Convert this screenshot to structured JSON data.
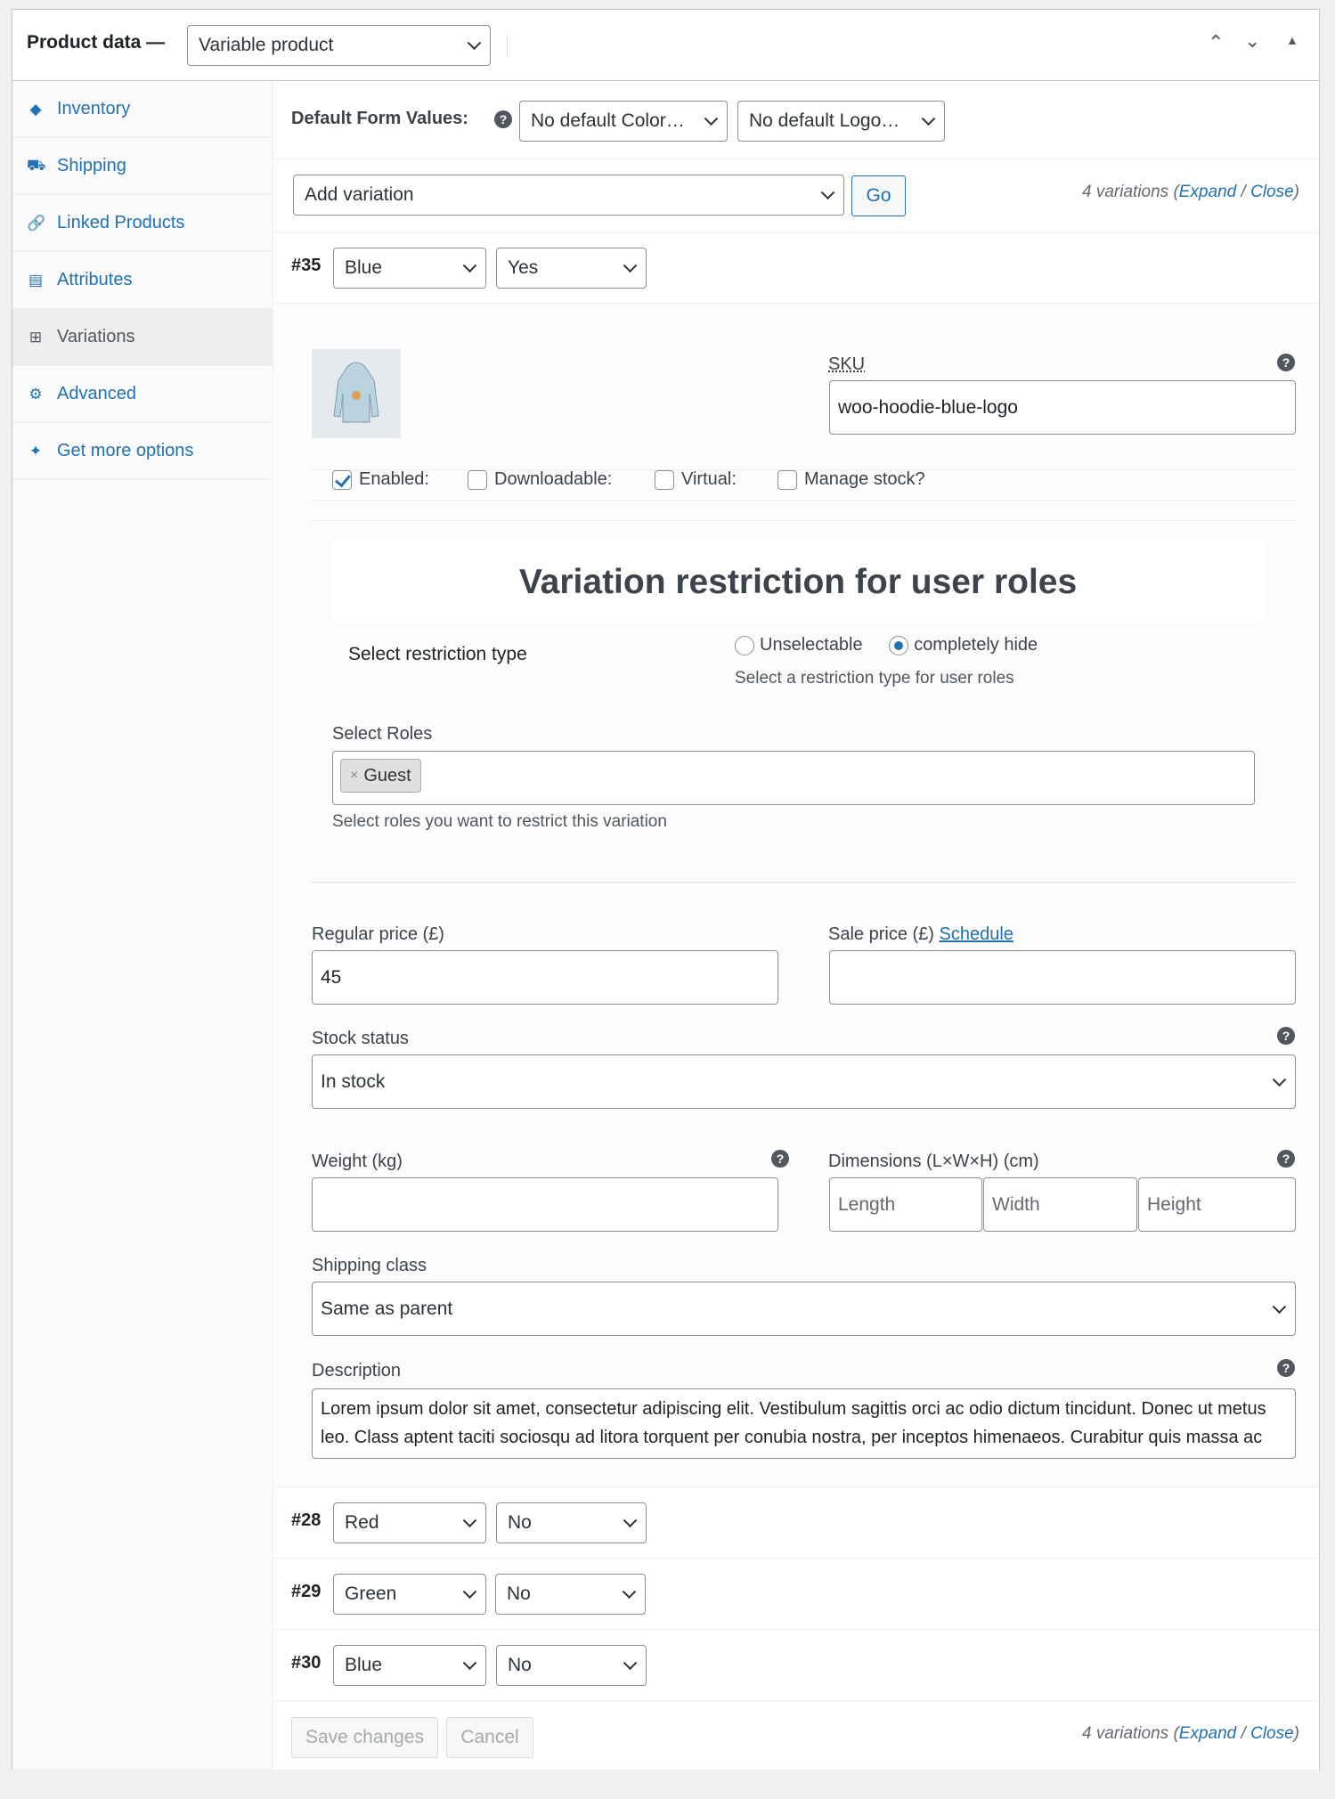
{
  "header": {
    "title": "Product data —",
    "product_type": "Variable product"
  },
  "sidebar": {
    "items": [
      {
        "label": "Inventory",
        "icon": "tag-icon"
      },
      {
        "label": "Shipping",
        "icon": "truck-icon"
      },
      {
        "label": "Linked Products",
        "icon": "link-icon"
      },
      {
        "label": "Attributes",
        "icon": "list-icon"
      },
      {
        "label": "Variations",
        "icon": "grid-icon"
      },
      {
        "label": "Advanced",
        "icon": "gear-icon"
      },
      {
        "label": "Get more options",
        "icon": "plugin-icon"
      }
    ]
  },
  "defaults": {
    "label": "Default Form Values:",
    "color": "No default Color…",
    "logo": "No default Logo…"
  },
  "toolbar": {
    "add_variation": "Add variation",
    "go": "Go",
    "count": "4 variations (",
    "expand": "Expand",
    "sep": " / ",
    "close": "Close",
    "end": ")"
  },
  "variations": [
    {
      "id": "#35",
      "color": "Blue",
      "logo": "Yes"
    },
    {
      "id": "#28",
      "color": "Red",
      "logo": "No"
    },
    {
      "id": "#29",
      "color": "Green",
      "logo": "No"
    },
    {
      "id": "#30",
      "color": "Blue",
      "logo": "No"
    }
  ],
  "expanded": {
    "sku_label": "SKU",
    "sku": "woo-hoodie-blue-logo",
    "enabled": "Enabled:",
    "downloadable": "Downloadable:",
    "virtual": "Virtual:",
    "manage_stock": "Manage stock?",
    "restriction_title": "Variation restriction for user roles",
    "restriction_type_label": "Select restriction type",
    "opt_unselectable": "Unselectable",
    "opt_hide": "completely hide",
    "restriction_help": "Select a restriction type for user roles",
    "roles_label": "Select Roles",
    "role_tag": "Guest",
    "roles_help": "Select roles you want to restrict this variation",
    "regular_price_label": "Regular price (£)",
    "regular_price": "45",
    "sale_price_label": "Sale price (£)",
    "schedule": "Schedule",
    "stock_status_label": "Stock status",
    "stock_status": "In stock",
    "weight_label": "Weight (kg)",
    "dimensions_label": "Dimensions (L×W×H) (cm)",
    "length_ph": "Length",
    "width_ph": "Width",
    "height_ph": "Height",
    "shipping_class_label": "Shipping class",
    "shipping_class": "Same as parent",
    "description_label": "Description",
    "description": "Lorem ipsum dolor sit amet, consectetur adipiscing elit. Vestibulum sagittis orci ac odio dictum tincidunt. Donec ut metus leo. Class aptent taciti sociosqu ad litora torquent per conubia nostra, per inceptos himenaeos. Curabitur quis massa ac lectus tincidunt"
  },
  "footer": {
    "save": "Save changes",
    "cancel": "Cancel"
  }
}
